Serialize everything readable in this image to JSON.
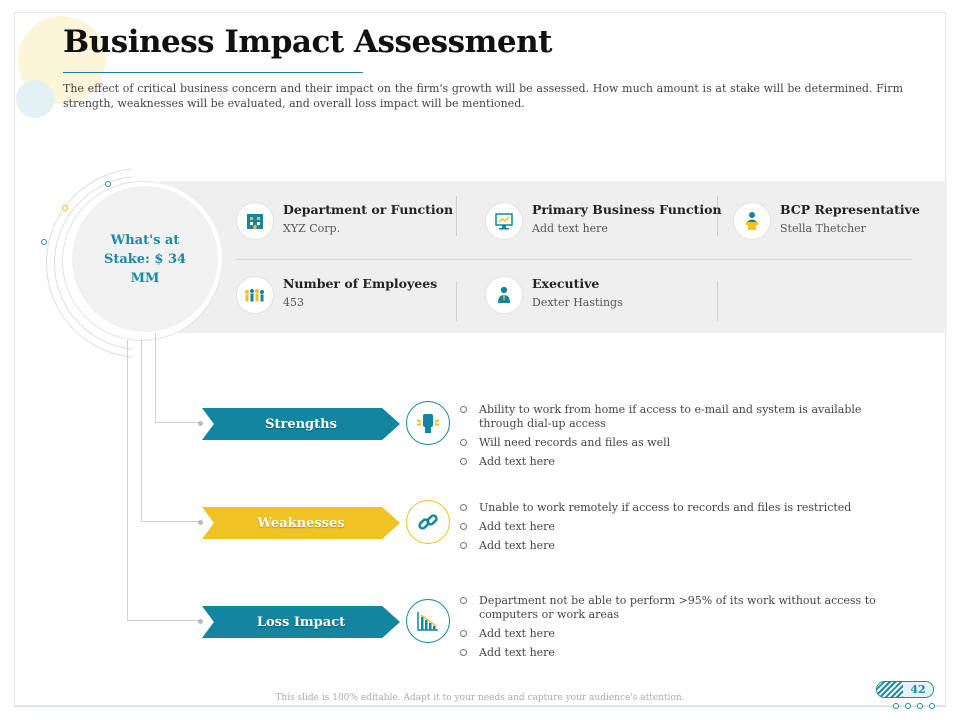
{
  "slide": {
    "title": "Business Impact Assessment",
    "intro": "The effect of critical business concern and their impact on the firm's growth will be assessed. How much amount is at stake will be determined. Firm strength, weaknesses will be evaluated, and overall loss impact will be mentioned.",
    "stake_text": "What's at Stake: $ 34 MM",
    "footer_note": "This slide is 100% editable. Adapt it to your needs and capture your audience's attention.",
    "page_number": "42"
  },
  "info": {
    "department": {
      "label": "Department or Function",
      "value": "XYZ Corp.",
      "icon": "building-icon"
    },
    "primary_function": {
      "label": "Primary Business Function",
      "value": "Add text here",
      "icon": "computer-chart-icon"
    },
    "bcp_rep": {
      "label": "BCP Representative",
      "value": "Stella Thetcher",
      "icon": "speaker-podium-icon"
    },
    "employees": {
      "label": "Number of Employees",
      "value": "453",
      "icon": "people-group-icon"
    },
    "executive": {
      "label": "Executive",
      "value": "Dexter Hastings",
      "icon": "businessman-icon"
    }
  },
  "sections": {
    "strengths": {
      "label": "Strengths",
      "icon": "fist-icon",
      "items": [
        "Ability to work from home if access to e-mail and system is available through dial-up access",
        "Will need records and files as well",
        "Add text here"
      ]
    },
    "weaknesses": {
      "label": "Weaknesses",
      "icon": "broken-link-icon",
      "items": [
        "Unable to work remotely if access to records and files is restricted",
        "Add text here",
        "Add text here"
      ]
    },
    "loss_impact": {
      "label": "Loss Impact",
      "icon": "declining-chart-icon",
      "items": [
        "Department not be able to perform >95% of its work without access to computers or work areas",
        "Add text here",
        "Add text here"
      ]
    }
  },
  "colors": {
    "teal": "#13859f",
    "gold": "#f0c224",
    "band": "#efefef"
  }
}
